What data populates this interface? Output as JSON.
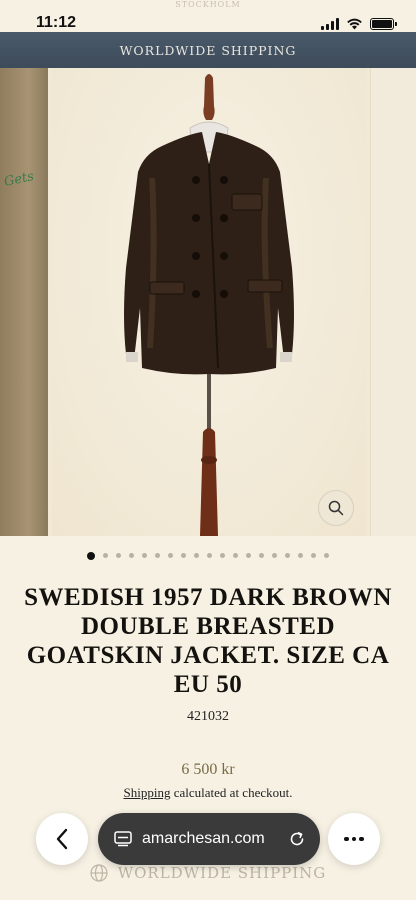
{
  "status_bar": {
    "time": "11:12",
    "faded_header": "STOCKHOLM"
  },
  "banner": {
    "text": "WORLDWIDE SHIPPING"
  },
  "gallery": {
    "slide_count": 19,
    "active_index": 0,
    "peek_left_text": "Gets"
  },
  "product": {
    "title": "SWEDISH 1957 DARK BROWN DOUBLE BREASTED GOATSKIN JACKET. SIZE CA EU 50",
    "sku": "421032",
    "price": "6 500 kr",
    "shipping_link": "Shipping",
    "shipping_rest": " calculated at checkout."
  },
  "footer_faded": {
    "text": "WORLDWIDE SHIPPING"
  },
  "browser": {
    "url": "amarchesan.com"
  },
  "colors": {
    "banner": "#3d4b5a",
    "background": "#f6f1e3",
    "price": "#7a6a45",
    "jacket": "#2e2016"
  },
  "icons": [
    "signal-icon",
    "wifi-icon",
    "battery-icon",
    "zoom-icon",
    "back-arrow-icon",
    "tabs-icon",
    "reload-icon",
    "more-icon",
    "globe-icon"
  ]
}
